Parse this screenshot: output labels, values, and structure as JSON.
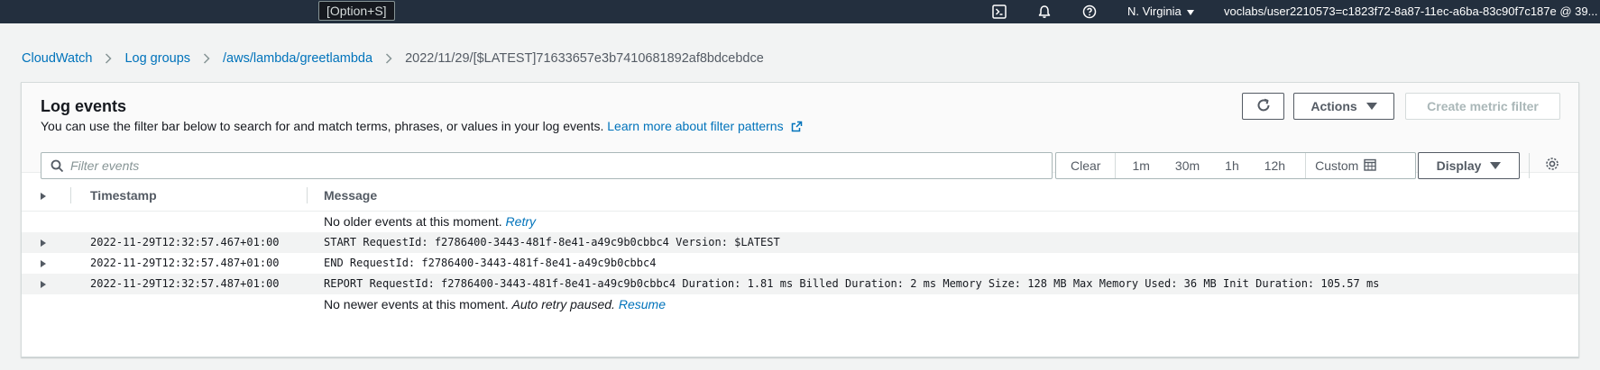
{
  "topbar": {
    "shortcut_hint": "[Option+S]",
    "icons": [
      "cloudshell-icon",
      "bell-icon",
      "help-icon"
    ],
    "region": "N. Virginia",
    "account": "voclabs/user2210573=c1823f72-8a87-11ec-a6ba-83c90f7c187e @ 39..."
  },
  "breadcrumb": {
    "items": [
      "CloudWatch",
      "Log groups",
      "/aws/lambda/greetlambda"
    ],
    "current": "2022/11/29/[$LATEST]71633657e3b7410681892af8bdcebdce"
  },
  "panel": {
    "title": "Log events",
    "description": "You can use the filter bar below to search for and match terms, phrases, or values in your log events.",
    "learn_more": "Learn more about filter patterns",
    "actions_label": "Actions",
    "create_metric_label": "Create metric filter",
    "filter_placeholder": "Filter events",
    "filter_value": "",
    "ranges": {
      "clear": "Clear",
      "r1m": "1m",
      "r30m": "30m",
      "r1h": "1h",
      "r12h": "12h",
      "custom": "Custom"
    },
    "display_label": "Display"
  },
  "table": {
    "columns": {
      "timestamp": "Timestamp",
      "message": "Message"
    },
    "top_notice": {
      "text": "No older events at this moment.",
      "link": "Retry"
    },
    "rows": [
      {
        "timestamp": "2022-11-29T12:32:57.467+01:00",
        "message": "START RequestId: f2786400-3443-481f-8e41-a49c9b0cbbc4 Version: $LATEST"
      },
      {
        "timestamp": "2022-11-29T12:32:57.487+01:00",
        "message": "END RequestId: f2786400-3443-481f-8e41-a49c9b0cbbc4"
      },
      {
        "timestamp": "2022-11-29T12:32:57.487+01:00",
        "message": "REPORT RequestId: f2786400-3443-481f-8e41-a49c9b0cbbc4 Duration: 1.81 ms Billed Duration: 2 ms Memory Size: 128 MB Max Memory Used: 36 MB Init Duration: 105.57 ms"
      }
    ],
    "bottom_notice": {
      "text": "No newer events at this moment.",
      "italic": "Auto retry paused.",
      "link": "Resume"
    }
  },
  "colors": {
    "nav_bg": "#232f3e",
    "link": "#0073bb",
    "page_bg": "#f2f3f3"
  }
}
